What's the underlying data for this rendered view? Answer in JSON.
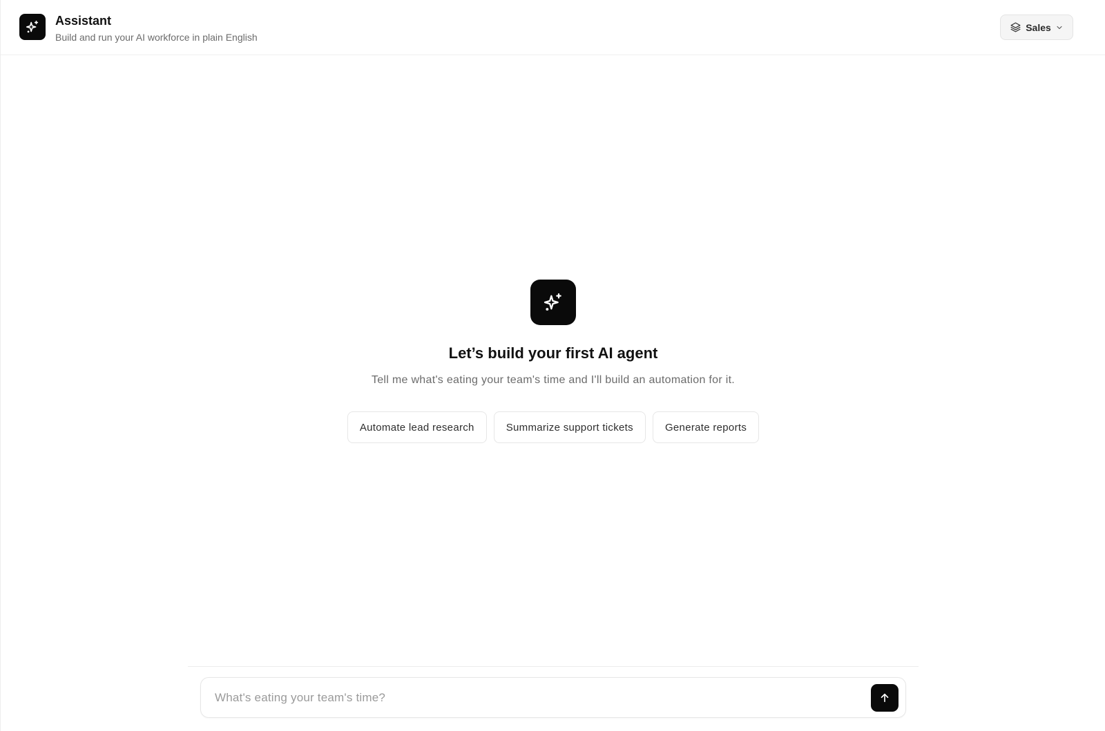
{
  "header": {
    "title": "Assistant",
    "subtitle": "Build and run your AI workforce in plain English",
    "workspace": {
      "label": "Sales",
      "icon": "layers-icon",
      "caret": "chevron-down-icon"
    },
    "logo_icon": "sparkles-icon"
  },
  "empty_state": {
    "icon": "sparkles-icon",
    "title": "Let’s build your first AI agent",
    "subtitle": "Tell me what's eating your team's time and I'll build an automation for it.",
    "suggestions": [
      "Automate lead research",
      "Summarize support tickets",
      "Generate reports"
    ]
  },
  "composer": {
    "placeholder": "What's eating your team's time?",
    "value": "",
    "send_icon": "arrow-up-icon"
  },
  "colors": {
    "accent": "#0a0a0a",
    "muted_text": "#6b6b6b",
    "border": "#e6e6e6"
  }
}
